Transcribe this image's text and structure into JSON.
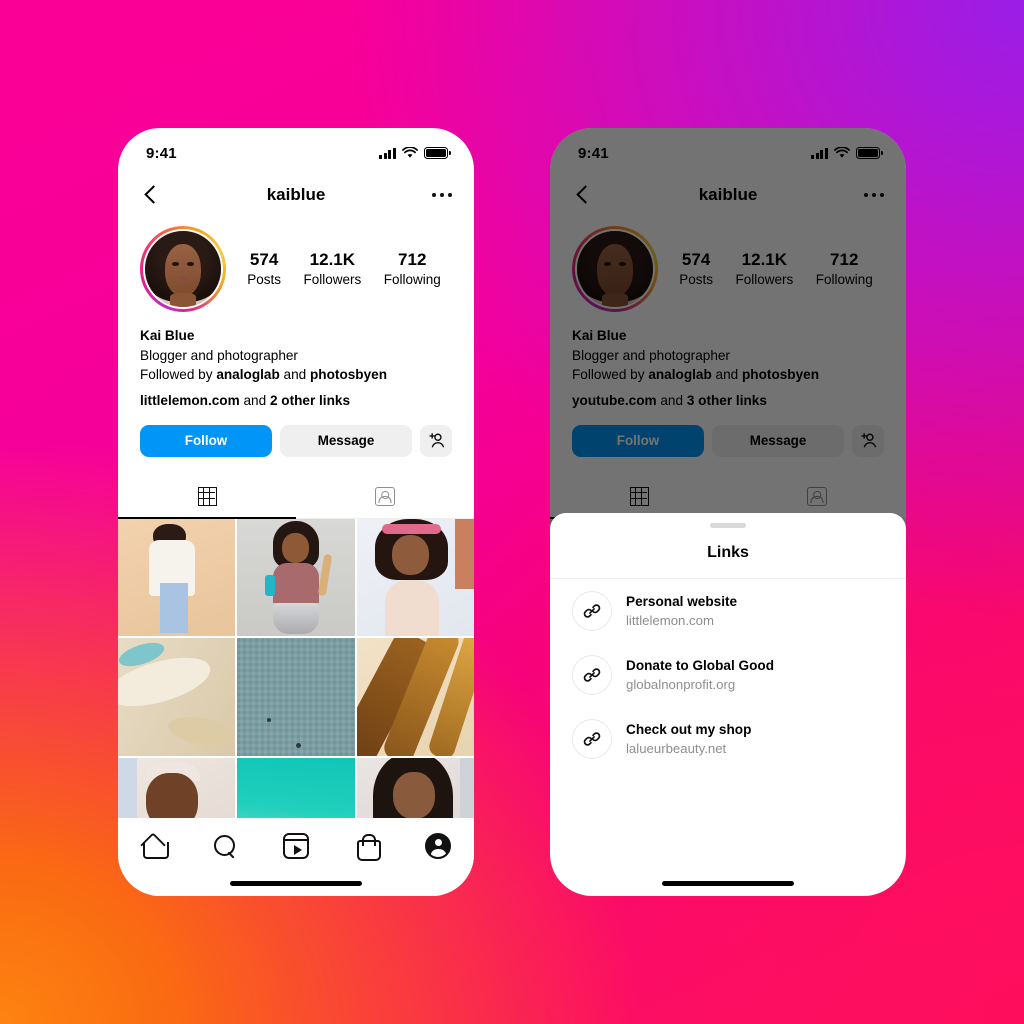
{
  "background": {
    "colors": [
      "#fb0096",
      "#9a1ee8",
      "#fd8310",
      "#ff0d5d"
    ]
  },
  "accents": {
    "follow_blue": "#0095f6",
    "secondary_grey": "#efefef",
    "muted_text": "#8e8e8e"
  },
  "status_bar": {
    "time": "9:41"
  },
  "nav": {
    "title": "kaiblue"
  },
  "profile": {
    "stats": [
      {
        "num": "574",
        "label": "Posts"
      },
      {
        "num": "12.1K",
        "label": "Followers"
      },
      {
        "num": "712",
        "label": "Following"
      }
    ],
    "name": "Kai Blue",
    "description": "Blogger and photographer",
    "followed_by_prefix": "Followed by ",
    "followed_by_1": "analoglab",
    "followed_by_join": " and ",
    "followed_by_2": "photosbyen"
  },
  "left_phone": {
    "link_primary": "littlelemon.com",
    "link_join": " and ",
    "link_more": "2 other links"
  },
  "right_phone": {
    "link_primary": "youtube.com",
    "link_join": " and ",
    "link_more": "3 other links"
  },
  "buttons": {
    "follow": "Follow",
    "message": "Message",
    "add_user": "+"
  },
  "tabs": [
    {
      "name": "grid",
      "icon": "grid-icon",
      "active": true
    },
    {
      "name": "tagged",
      "icon": "tagged-person-icon",
      "active": false
    }
  ],
  "bottom_nav": [
    {
      "icon": "home-icon",
      "label": "Home"
    },
    {
      "icon": "search-icon",
      "label": "Search"
    },
    {
      "icon": "reels-icon",
      "label": "Reels"
    },
    {
      "icon": "shop-icon",
      "label": "Shop"
    },
    {
      "icon": "profile-icon",
      "label": "Profile"
    }
  ],
  "sheet": {
    "title": "Links",
    "links": [
      {
        "title": "Personal website",
        "url": "littlelemon.com",
        "icon": "link-icon"
      },
      {
        "title": "Donate to Global Good",
        "url": "globalnonprofit.org",
        "icon": "link-icon"
      },
      {
        "title": "Check out my shop",
        "url": "lalueurbeauty.net",
        "icon": "link-icon"
      }
    ]
  },
  "photo_grid": [
    {
      "alt": "woman in white coat and jeans on tan background"
    },
    {
      "alt": "woman cooking with pot and utensils"
    },
    {
      "alt": "smiling woman with pink headband"
    },
    {
      "alt": "abstract sand and water aerial"
    },
    {
      "alt": "aerial of beach umbrellas"
    },
    {
      "alt": "amber oil bottles on sand"
    },
    {
      "alt": "woman with white headband skincare"
    },
    {
      "alt": "turquoise sea with coastal town"
    },
    {
      "alt": "portrait of woman with long hair"
    }
  ]
}
